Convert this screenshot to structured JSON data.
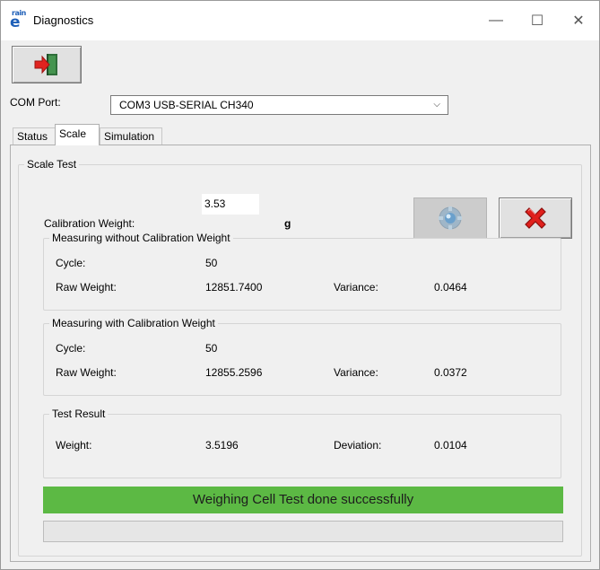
{
  "window": {
    "logo_small": "rain",
    "logo_big": "e",
    "title": "Diagnostics",
    "minimize_glyph": "—",
    "maximize_glyph": "☐",
    "close_glyph": "✕"
  },
  "toolbar": {
    "exit_icon": "exit-door-icon"
  },
  "com_port": {
    "label": "COM Port:",
    "selected": "COM3  USB-SERIAL CH340",
    "chevron": "⌵"
  },
  "tabs": [
    {
      "label": "Status",
      "active": false
    },
    {
      "label": "Scale",
      "active": true
    },
    {
      "label": "Simulation",
      "active": false
    }
  ],
  "scale_test": {
    "title": "Scale Test",
    "calibration_label": "Calibration Weight:",
    "calibration_value": "3.53",
    "calibration_unit": "g",
    "start_icon": "gear-start-icon",
    "cancel_icon": "red-x-icon",
    "without": {
      "title": "Measuring without Calibration Weight",
      "cycle_label": "Cycle:",
      "cycle_value": "50",
      "raw_label": "Raw Weight:",
      "raw_value": "12851.7400",
      "variance_label": "Variance:",
      "variance_value": "0.0464"
    },
    "with": {
      "title": "Measuring with Calibration Weight",
      "cycle_label": "Cycle:",
      "cycle_value": "50",
      "raw_label": "Raw Weight:",
      "raw_value": "12855.2596",
      "variance_label": "Variance:",
      "variance_value": "0.0372"
    },
    "result": {
      "title": "Test Result",
      "weight_label": "Weight:",
      "weight_value": "3.5196",
      "deviation_label": "Deviation:",
      "deviation_value": "0.0104"
    },
    "status_message": "Weighing Cell Test done successfully",
    "progress_fraction": 0
  },
  "colors": {
    "success": "#5cb944",
    "window_bg": "#f0f0f0"
  }
}
